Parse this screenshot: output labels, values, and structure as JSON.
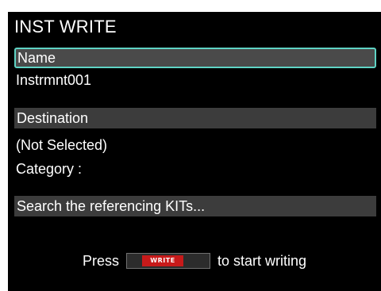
{
  "screen": {
    "title": "INST WRITE"
  },
  "fields": {
    "name_label": "Name",
    "name_value": "Instrmnt001",
    "destination_label": "Destination",
    "destination_value": "(Not Selected)",
    "category_value": "Category :",
    "search_label": "Search the referencing KITs..."
  },
  "footer": {
    "press_text": "Press",
    "write_button_label": "WRITE",
    "suffix_text": "to start writing"
  },
  "colors": {
    "screen_bg": "#000000",
    "row_bg": "#3c3c3c",
    "selected_outline": "#5fd3c4",
    "write_button": "#c71a1a"
  }
}
